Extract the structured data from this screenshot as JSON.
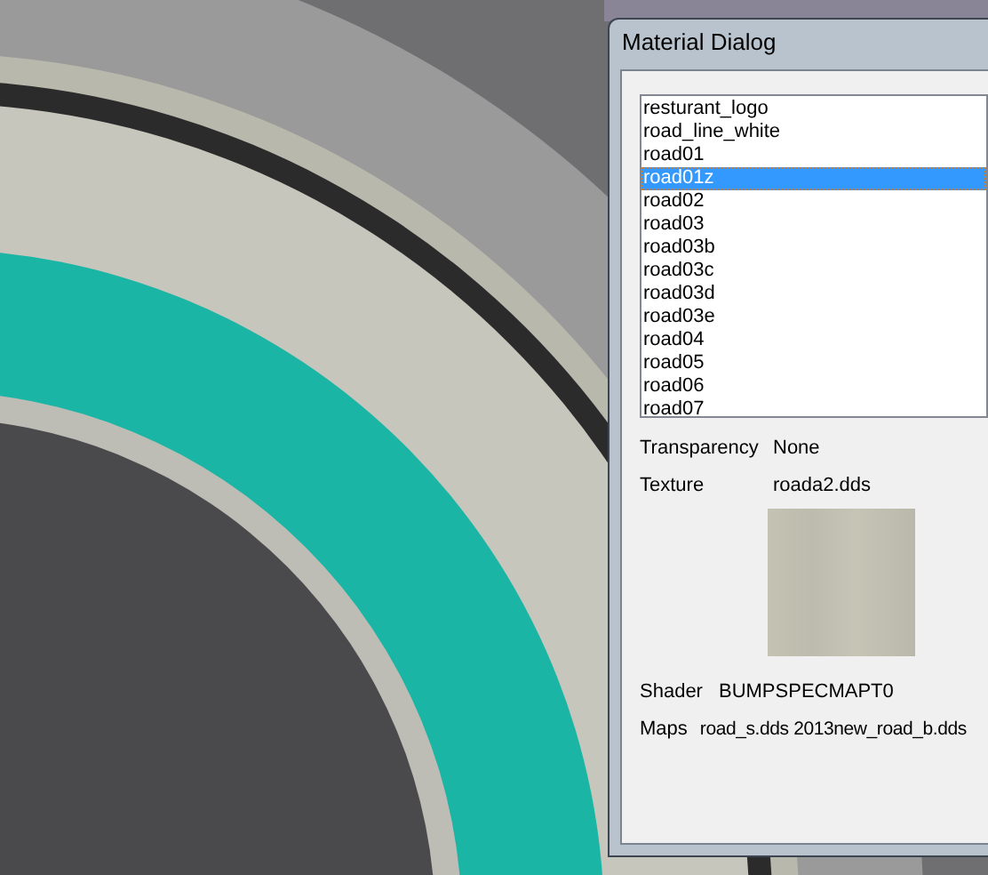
{
  "dialog": {
    "title": "Material Dialog",
    "materials": [
      {
        "label": "resturant_logo",
        "selected": false
      },
      {
        "label": "road_line_white",
        "selected": false
      },
      {
        "label": "road01",
        "selected": false
      },
      {
        "label": "road01z",
        "selected": true
      },
      {
        "label": "road02",
        "selected": false
      },
      {
        "label": "road03",
        "selected": false
      },
      {
        "label": "road03b",
        "selected": false
      },
      {
        "label": "road03c",
        "selected": false
      },
      {
        "label": "road03d",
        "selected": false
      },
      {
        "label": "road03e",
        "selected": false
      },
      {
        "label": "road04",
        "selected": false
      },
      {
        "label": "road05",
        "selected": false
      },
      {
        "label": "road06",
        "selected": false
      },
      {
        "label": "road07",
        "selected": false
      }
    ],
    "transparency": {
      "label": "Transparency",
      "value": "None"
    },
    "texture": {
      "label": "Texture",
      "value": "roada2.dds"
    },
    "shader": {
      "label": "Shader",
      "value": "BUMPSPECMAPT0"
    },
    "maps": {
      "label": "Maps",
      "value": "road_s.dds 2013new_road_b.dds"
    }
  }
}
